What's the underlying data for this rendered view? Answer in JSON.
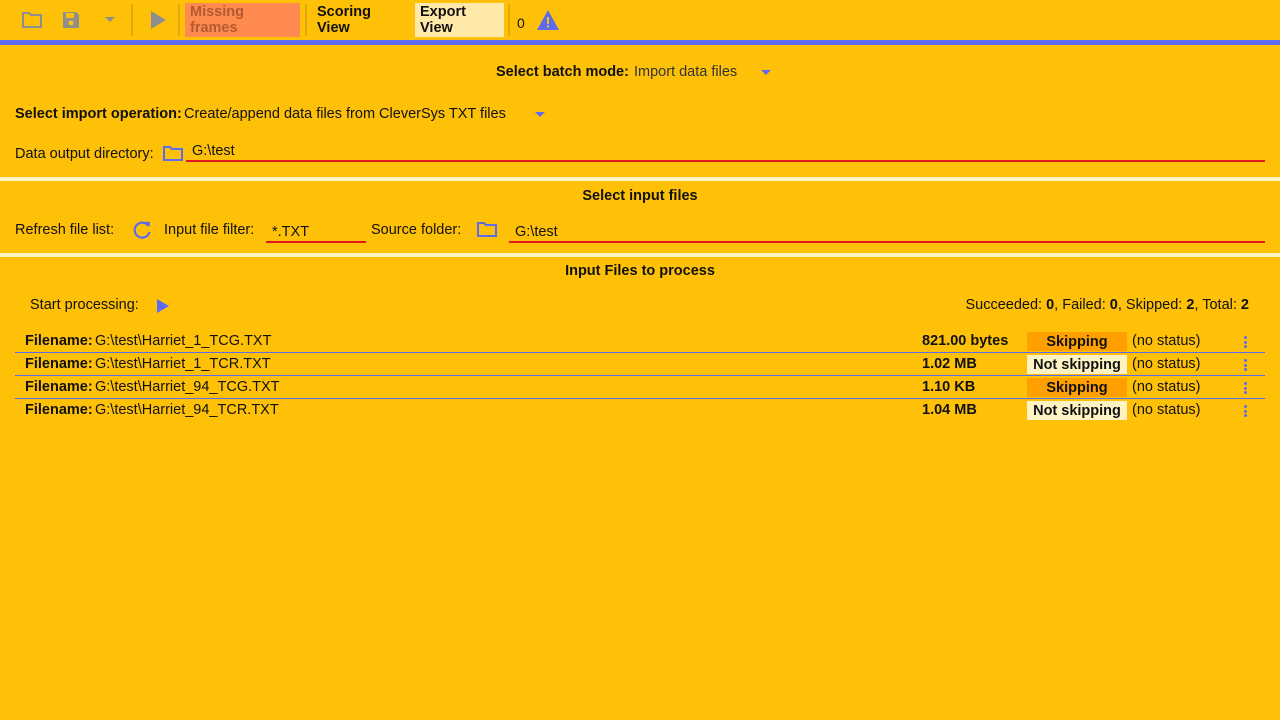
{
  "toolbar": {
    "icons": [
      "folder-open-icon",
      "save-icon",
      "dropdown-arrow-icon",
      "play-icon",
      "warning-icon"
    ],
    "missing_frames_label": "Missing frames",
    "scoring_view_label": "Scoring View",
    "export_view_label": "Export View",
    "warning_count": "0"
  },
  "batch": {
    "mode_label": "Select batch mode:",
    "mode_value": "Import data files",
    "operation_label": "Select import operation:",
    "operation_value": "Create/append data files from CleverSys TXT files",
    "output_dir_label": "Data output directory:",
    "output_dir_value": "G:\\test"
  },
  "input_section": {
    "title": "Select input files",
    "refresh_label": "Refresh file list:",
    "filter_label": "Input file filter:",
    "filter_value": "*.TXT",
    "source_label": "Source folder:",
    "source_value": "G:\\test"
  },
  "process_section": {
    "title": "Input Files to process",
    "start_label": "Start processing:",
    "stats": {
      "succeeded_label": "Succeeded: ",
      "succeeded": "0",
      "failed_label": ", Failed: ",
      "failed": "0",
      "skipped_label": ", Skipped: ",
      "skipped": "2",
      "total_label": ", Total: ",
      "total": "2"
    }
  },
  "files": [
    {
      "label": "Filename:",
      "path": "G:\\test\\Harriet_1_TCG.TXT",
      "size": "821.00 bytes",
      "skip": "Skipping",
      "status": "(no status)"
    },
    {
      "label": "Filename:",
      "path": "G:\\test\\Harriet_1_TCR.TXT",
      "size": "1.02 MB",
      "skip": "Not skipping",
      "status": "(no status)"
    },
    {
      "label": "Filename:",
      "path": "G:\\test\\Harriet_94_TCG.TXT",
      "size": "1.10 KB",
      "skip": "Skipping",
      "status": "(no status)"
    },
    {
      "label": "Filename:",
      "path": "G:\\test\\Harriet_94_TCR.TXT",
      "size": "1.04 MB",
      "skip": "Not skipping",
      "status": "(no status)"
    }
  ],
  "colors": {
    "background": "#FFC107",
    "accent": "#5C6BF0",
    "missing_frames_bg": "#FF8A50",
    "export_view_bg": "#FFE9A8",
    "skip_bg": "#FFA000",
    "noskip_bg": "#FFF3C4",
    "error_underline": "#E4161E"
  }
}
